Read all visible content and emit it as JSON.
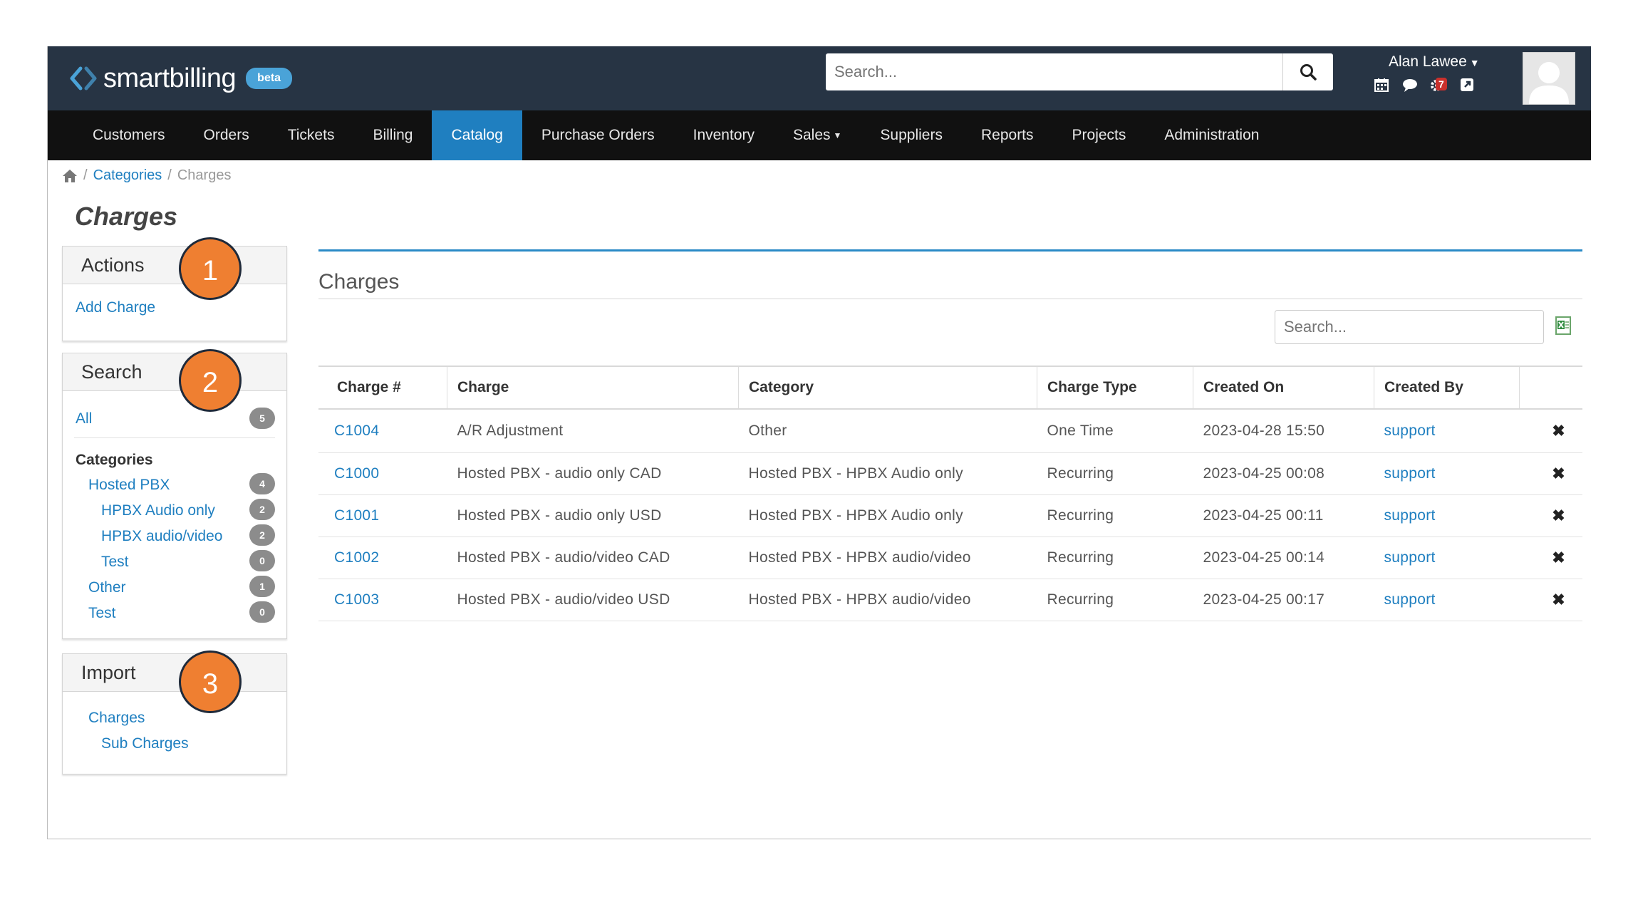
{
  "app": {
    "brand": "smartbilling",
    "beta_label": "beta"
  },
  "header": {
    "search_placeholder": "Search...",
    "user_name": "Alan Lawee",
    "notification_count": "7"
  },
  "nav": {
    "items": [
      {
        "label": "Customers"
      },
      {
        "label": "Orders"
      },
      {
        "label": "Tickets"
      },
      {
        "label": "Billing"
      },
      {
        "label": "Catalog",
        "active": true
      },
      {
        "label": "Purchase Orders"
      },
      {
        "label": "Inventory"
      },
      {
        "label": "Sales",
        "dropdown": true
      },
      {
        "label": "Suppliers"
      },
      {
        "label": "Reports"
      },
      {
        "label": "Projects"
      },
      {
        "label": "Administration"
      }
    ]
  },
  "breadcrumb": {
    "sep": "/",
    "categories": "Categories",
    "current": "Charges"
  },
  "page": {
    "title": "Charges"
  },
  "sidebar": {
    "actions": {
      "title": "Actions",
      "add_charge": "Add Charge"
    },
    "search": {
      "title": "Search",
      "all_label": "All",
      "all_count": "5",
      "categories_heading": "Categories",
      "items": [
        {
          "label": "Hosted PBX",
          "count": "4"
        },
        {
          "label": "HPBX Audio only",
          "count": "2"
        },
        {
          "label": "HPBX audio/video",
          "count": "2"
        },
        {
          "label": "Test",
          "count": "0"
        },
        {
          "label": "Other",
          "count": "1"
        },
        {
          "label": "Test",
          "count": "0"
        }
      ]
    },
    "import": {
      "title": "Import",
      "charges": "Charges",
      "sub_charges": "Sub Charges"
    }
  },
  "callouts": [
    "1",
    "2",
    "3"
  ],
  "main": {
    "title": "Charges",
    "search_placeholder": "Search...",
    "columns": [
      "Charge #",
      "Charge",
      "Category",
      "Charge Type",
      "Created On",
      "Created By"
    ],
    "delete_glyph": "✖",
    "rows": [
      {
        "num": "C1004",
        "charge": "A/R Adjustment",
        "category": "Other",
        "type": "One Time",
        "created_on": "2023-04-28 15:50",
        "created_by": "support"
      },
      {
        "num": "C1000",
        "charge": "Hosted PBX - audio only CAD",
        "category": "Hosted PBX - HPBX Audio only",
        "type": "Recurring",
        "created_on": "2023-04-25 00:08",
        "created_by": "support"
      },
      {
        "num": "C1001",
        "charge": "Hosted PBX - audio only USD",
        "category": "Hosted PBX - HPBX Audio only",
        "type": "Recurring",
        "created_on": "2023-04-25 00:11",
        "created_by": "support"
      },
      {
        "num": "C1002",
        "charge": "Hosted PBX - audio/video CAD",
        "category": "Hosted PBX - HPBX audio/video",
        "type": "Recurring",
        "created_on": "2023-04-25 00:14",
        "created_by": "support"
      },
      {
        "num": "C1003",
        "charge": "Hosted PBX - audio/video USD",
        "category": "Hosted PBX - HPBX audio/video",
        "type": "Recurring",
        "created_on": "2023-04-25 00:17",
        "created_by": "support"
      }
    ]
  },
  "colors": {
    "topbar": "#273444",
    "navbar": "#111111",
    "accent": "#1f7fc0",
    "callout": "#ef7f31"
  }
}
